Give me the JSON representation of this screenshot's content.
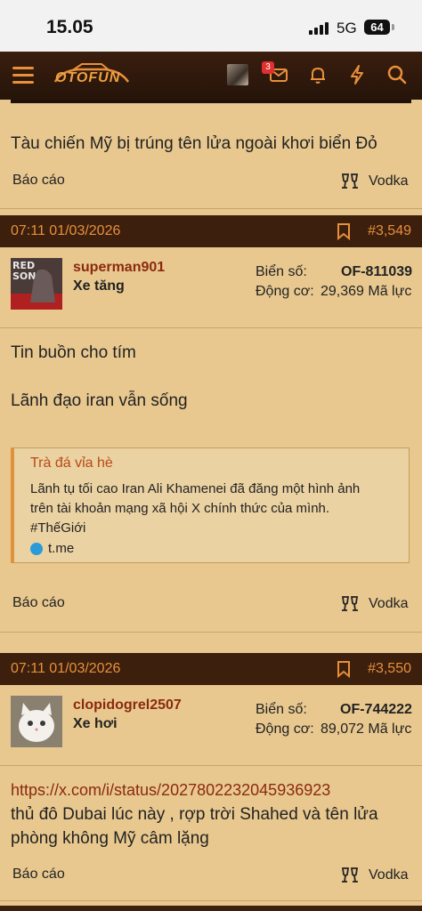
{
  "status_bar": {
    "time": "15.05",
    "network": "5G",
    "battery": "64"
  },
  "nav": {
    "logo": "OTOFUN",
    "mail_badge": "3"
  },
  "post0": {
    "body": "Tàu chiến Mỹ bị trúng tên lửa ngoài khơi biển Đỏ",
    "report": "Báo cáo",
    "liked_by": "Vodka"
  },
  "post1": {
    "datetime": "07:11 01/03/2026",
    "number": "#3,549",
    "username": "superman901",
    "rank": "Xe tăng",
    "plate_label": "Biển số:",
    "plate": "OF-811039",
    "engine_label": "Động cơ:",
    "engine": "29,369 Mã lực",
    "lines": [
      "Tin buồn cho tím",
      "Lãnh đạo iran vẫn sống"
    ],
    "quote": {
      "source": "Trà đá vỉa hè",
      "line1": "Lãnh tụ tối cao Iran Ali Khamenei đã đăng một hình ảnh",
      "line2": "trên tài khoản mạng xã hội X chính thức của mình.",
      "line3": "#ThếGiới",
      "link": "t.me"
    },
    "report": "Báo cáo",
    "liked_by": "Vodka"
  },
  "post2": {
    "datetime": "07:11 01/03/2026",
    "number": "#3,550",
    "username": "clopidogrel2507",
    "rank": "Xe hơi",
    "plate_label": "Biển số:",
    "plate": "OF-744222",
    "engine_label": "Động cơ:",
    "engine": "89,072 Mã lực",
    "url": "https://x.com/i/status/2027802232045936923",
    "line1": "thủ đô Dubai lúc này , rợp trời Shahed và tên lửa",
    "line2": "phòng không Mỹ câm lặng",
    "report": "Báo cáo",
    "liked_by": "Vodka"
  }
}
